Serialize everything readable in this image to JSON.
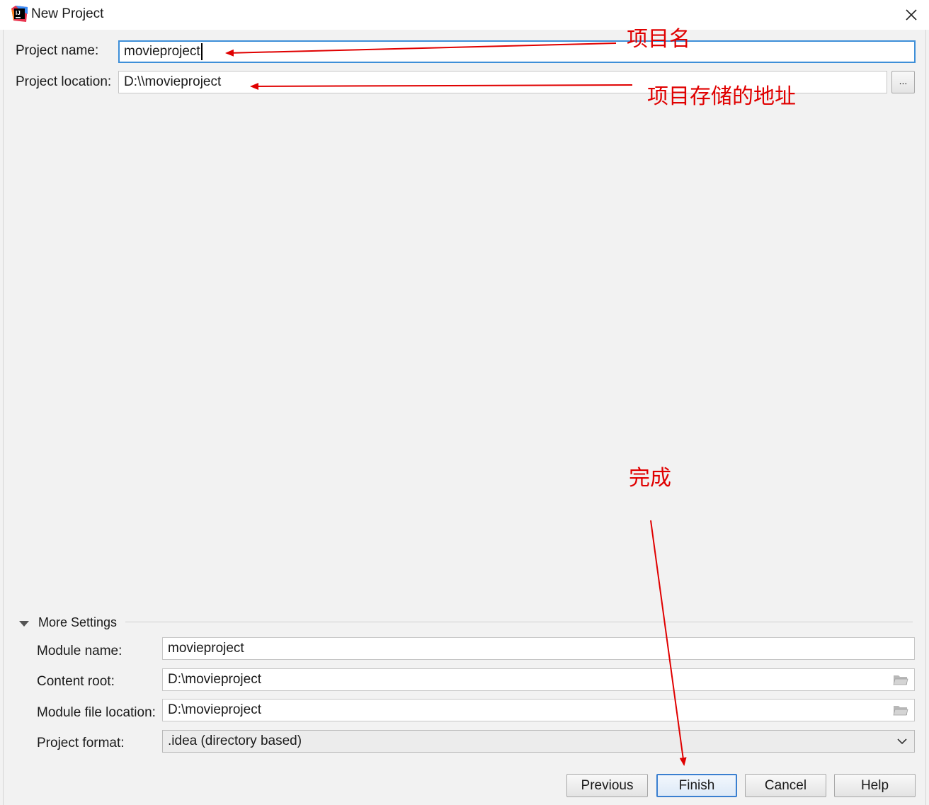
{
  "window": {
    "title": "New Project",
    "icon": "intellij-idea-icon",
    "close_icon": "close-icon"
  },
  "project": {
    "name_label": "Project name:",
    "name_value": "movieproject",
    "location_label": "Project location:",
    "location_value": "D:\\\\movieproject",
    "browse_label": "..."
  },
  "more_settings": {
    "label": "More Settings",
    "expanded": true,
    "module_name_label": "Module name:",
    "module_name_value": "movieproject",
    "content_root_label": "Content root:",
    "content_root_value": "D:\\movieproject",
    "module_file_label": "Module file location:",
    "module_file_value": "D:\\movieproject",
    "format_label": "Project format:",
    "format_value": ".idea (directory based)"
  },
  "buttons": {
    "previous": "Previous",
    "finish": "Finish",
    "cancel": "Cancel",
    "help": "Help"
  },
  "annotations": {
    "project_name_note": "项目名",
    "project_location_note": "项目存储的地址",
    "finish_note": "完成",
    "color": "#e00000"
  }
}
